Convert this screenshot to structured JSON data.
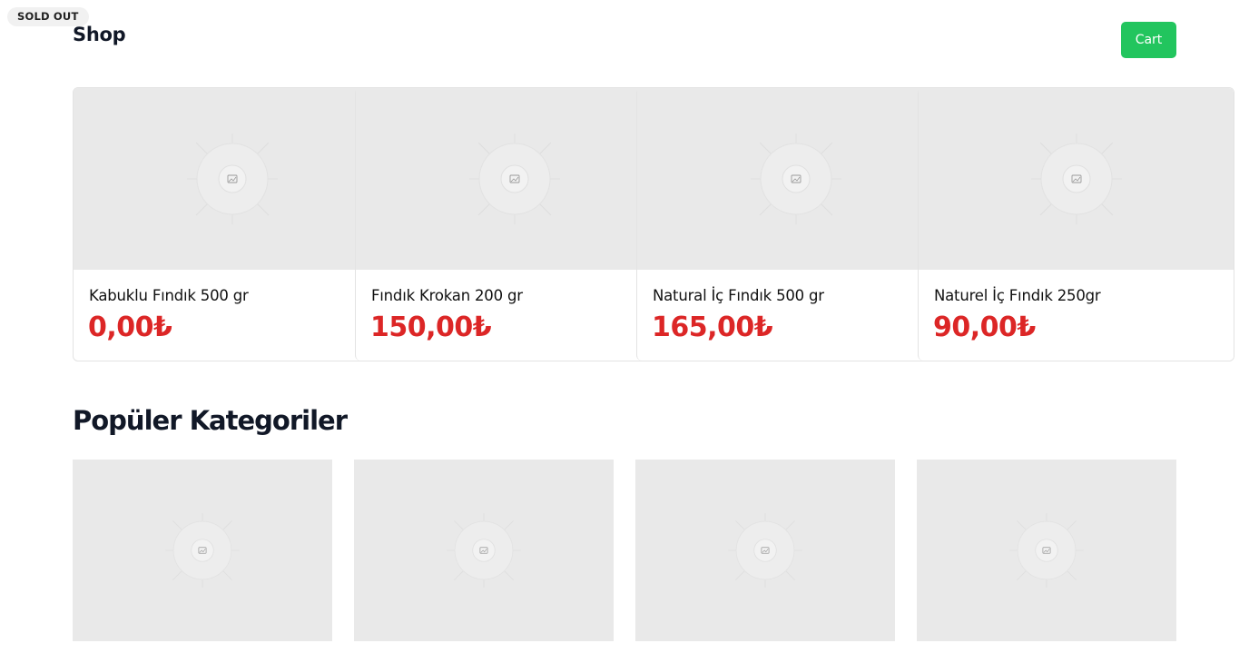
{
  "badge": {
    "label": "SOLD OUT"
  },
  "header": {
    "title": "Shop",
    "cart_label": "Cart"
  },
  "products": [
    {
      "name": "Kabuklu Fındık 500 gr",
      "price": "0,00₺"
    },
    {
      "name": "Fındık Krokan 200 gr",
      "price": "150,00₺"
    },
    {
      "name": "Natural İç Fındık 500 gr",
      "price": "165,00₺"
    },
    {
      "name": "Naturel İç Fındık 250gr",
      "price": "90,00₺"
    }
  ],
  "categories": {
    "title": "Popüler Kategoriler",
    "count_visible": 4
  },
  "colors": {
    "accent": "#22c55e",
    "price": "#dc2626",
    "placeholder_bg": "#e9e9e9"
  },
  "icons": {
    "placeholder": "image-placeholder-icon"
  }
}
